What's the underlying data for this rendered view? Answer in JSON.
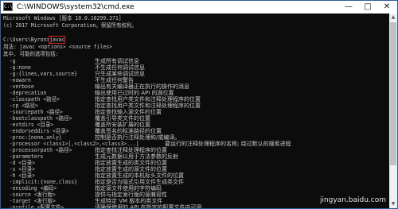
{
  "window": {
    "title": "C:\\WINDOWS\\system32\\cmd.exe",
    "minimize_glyph": "—",
    "maximize_glyph": "□",
    "close_glyph": "✕",
    "icon": "cmd-icon",
    "icon_glyph": "C:\\"
  },
  "console": {
    "banner_1": "Microsoft Windows [版本 10.0.16299.371]",
    "banner_2": "(c) 2017 Microsoft Corporation。保留所有权利。",
    "prompt": "C:\\Users\\Byron>",
    "command": "javac",
    "usage": "用法: javac <options> <source files>",
    "options_header": "其中, 可能的选项包括:",
    "options": [
      {
        "flag": "  -g",
        "desc": "生成所有调试信息"
      },
      {
        "flag": "  -g:none",
        "desc": "不生成任何调试信息"
      },
      {
        "flag": "  -g:{lines,vars,source}",
        "desc": "只生成某些调试信息"
      },
      {
        "flag": "  -nowarn",
        "desc": "不生成任何警告"
      },
      {
        "flag": "  -verbose",
        "desc": "输出有关编译器正在执行的操作的消息"
      },
      {
        "flag": "  -deprecation",
        "desc": "输出使用已过时的 API 的源位置"
      },
      {
        "flag": "  -classpath <路径>",
        "desc": "指定查找用户类文件和注释处理程序的位置"
      },
      {
        "flag": "  -cp <路径>",
        "desc": "指定查找用户类文件和注释处理程序的位置"
      },
      {
        "flag": "  -sourcepath <路径>",
        "desc": "指定查找输入源文件的位置"
      },
      {
        "flag": "  -bootclasspath <路径>",
        "desc": "覆盖引导类文件的位置"
      },
      {
        "flag": "  -extdirs <目录>",
        "desc": "覆盖所安装扩展的位置"
      },
      {
        "flag": "  -endorseddirs <目录>",
        "desc": "覆盖签名的标准路径的位置"
      },
      {
        "flag": "  -proc:{none,only}",
        "desc": "控制是否执行注释处理和/或编译。"
      },
      {
        "flag": "  -processor <class1>[,<class2>,<class3>...] ",
        "desc": "要运行的注释处理程序的名称; 绕过默认的搜索进程"
      },
      {
        "flag": "  -processorpath <路径>",
        "desc": "指定查找注释处理程序的位置"
      },
      {
        "flag": "  -parameters",
        "desc": "生成元数据以用于方法参数的反射"
      },
      {
        "flag": "  -d <目录>",
        "desc": "指定放置生成的类文件的位置"
      },
      {
        "flag": "  -s <目录>",
        "desc": "指定放置生成的源文件的位置"
      },
      {
        "flag": "  -h <目录>",
        "desc": "指定放置生成的本机标头文件的位置"
      },
      {
        "flag": "  -implicit:{none,class}",
        "desc": "指定是否为隐式引用文件生成类文件"
      },
      {
        "flag": "  -encoding <编码>",
        "desc": "指定源文件使用的字符编码"
      },
      {
        "flag": "  -source <发行版>",
        "desc": "提供与指定发行版的源兼容性"
      },
      {
        "flag": "  -target <发行版>",
        "desc": "生成特定 VM 版本的类文件"
      },
      {
        "flag": "  -profile <配置文件>",
        "desc": "请确保使用的 API 在指定的配置文件中可用"
      }
    ]
  },
  "scrollbar": {
    "up_glyph": "▲",
    "down_glyph": "▼"
  },
  "watermark": {
    "text": "jingyan.baidu.com"
  },
  "colors": {
    "console_bg": "#0c0c0c",
    "console_text": "#c7c7c7",
    "highlight_box": "#e0201b",
    "titlebar_bg": "#ffffff"
  }
}
